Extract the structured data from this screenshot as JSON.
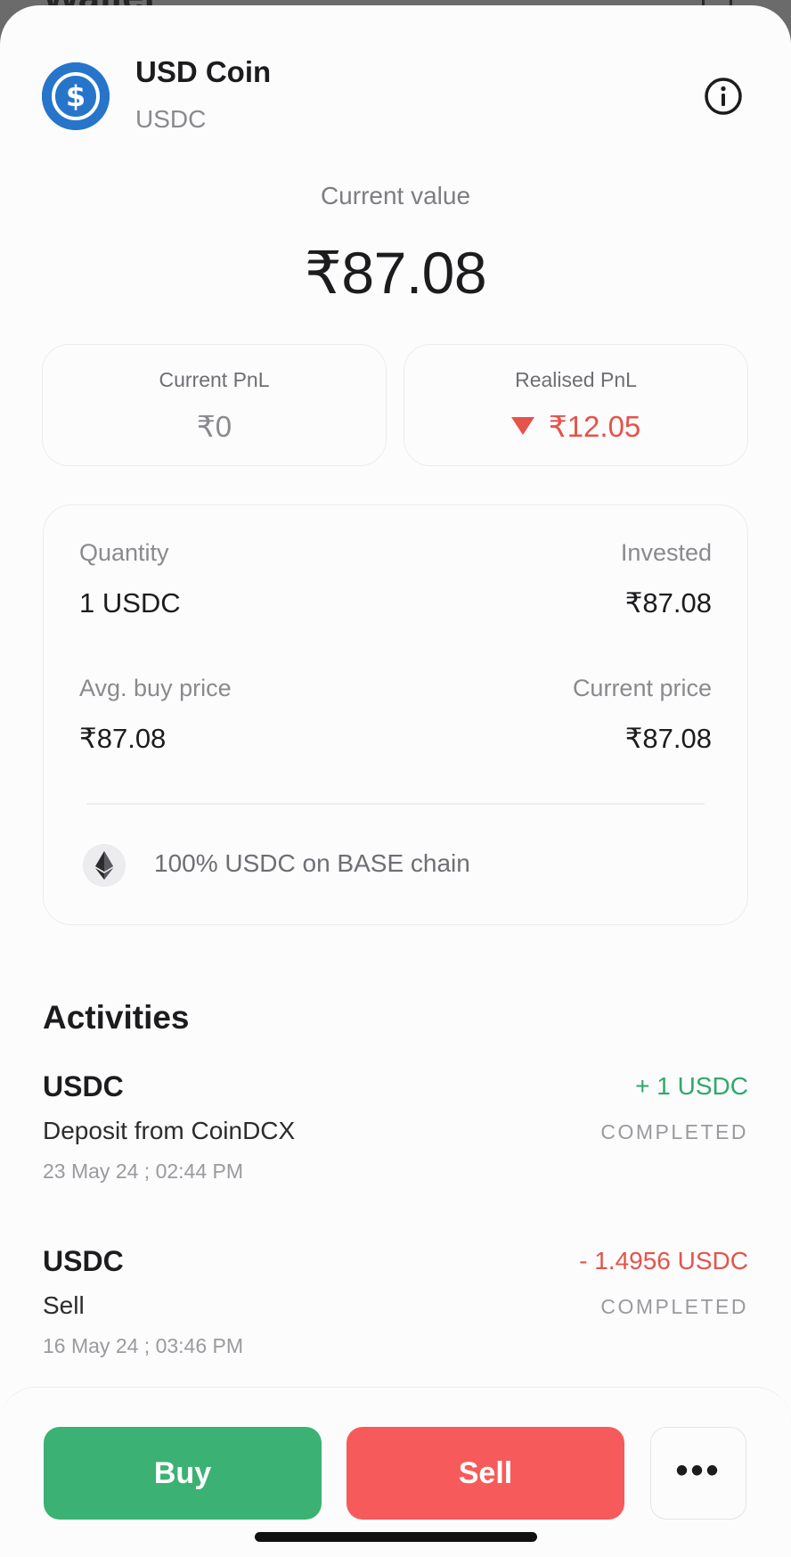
{
  "background": {
    "title": "Wallet"
  },
  "coin": {
    "name": "USD Coin",
    "symbol": "USDC",
    "brand_color": "#2775ca"
  },
  "current_value": {
    "label": "Current value",
    "value": "₹87.08"
  },
  "pnl": {
    "current": {
      "label": "Current PnL",
      "value": "₹0"
    },
    "realised": {
      "label": "Realised PnL",
      "value": "₹12.05",
      "direction": "down"
    }
  },
  "holdings": {
    "quantity_label": "Quantity",
    "quantity_value": "1 USDC",
    "invested_label": "Invested",
    "invested_value": "₹87.08",
    "avg_buy_label": "Avg. buy price",
    "avg_buy_value": "₹87.08",
    "current_price_label": "Current price",
    "current_price_value": "₹87.08",
    "chain_text": "100% USDC on BASE chain",
    "chain_icon": "ethereum-icon"
  },
  "activities": {
    "title": "Activities",
    "items": [
      {
        "name": "USDC",
        "description": "Deposit from CoinDCX",
        "date": "23 May 24 ; 02:44 PM",
        "amount": "+ 1 USDC",
        "status": "COMPLETED"
      },
      {
        "name": "USDC",
        "description": "Sell",
        "date": "16 May 24 ; 03:46 PM",
        "amount": "- 1.4956 USDC",
        "status": "COMPLETED"
      }
    ]
  },
  "actions": {
    "buy_label": "Buy",
    "sell_label": "Sell",
    "more_label": "•••"
  },
  "colors": {
    "buy": "#3bb273",
    "sell": "#f75a5a",
    "positive": "#2fa86a",
    "negative": "#e5534b"
  }
}
